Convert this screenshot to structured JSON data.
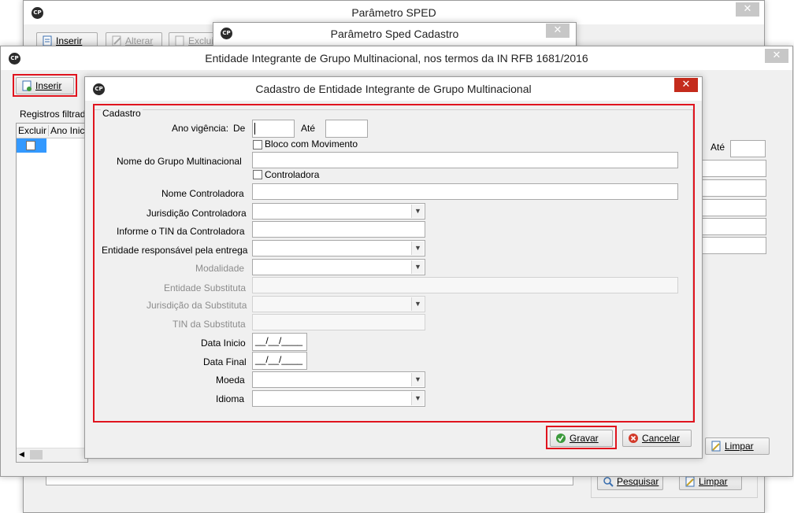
{
  "win_sped": {
    "title": "Parâmetro SPED",
    "toolbar": {
      "inserir": "Inserir",
      "alterar": "Alterar",
      "excluir": "Excluir"
    },
    "bottom": {
      "pesquisar": "Pesquisar",
      "limpar": "Limpar"
    }
  },
  "win_sped_cadastro": {
    "title": "Parâmetro Sped Cadastro"
  },
  "win_entidade": {
    "title": "Entidade Integrante de Grupo Multinacional, nos termos da IN RFB 1681/2016",
    "inserir": "Inserir",
    "registros_label": "Registros filtrados",
    "columns": [
      "Excluir",
      "Ano Inicio"
    ],
    "filter_ate": "Até",
    "limpar": "Limpar"
  },
  "dialog": {
    "title": "Cadastro de Entidade Integrante de Grupo Multinacional",
    "group_label": "Cadastro",
    "ano_vigencia_label": "Ano vigência:",
    "de_label": "De",
    "ate_label": "Até",
    "ano_de_value": "",
    "ano_ate_value": "",
    "bloco_label": "Bloco com Movimento",
    "nome_grupo_label": "Nome do Grupo Multinacional",
    "controladora_chk_label": "Controladora",
    "nome_controladora_label": "Nome Controladora",
    "jurisdicao_controladora_label": "Jurisdição Controladora",
    "tin_controladora_label": "Informe o TIN da Controladora",
    "entidade_responsavel_label": "Entidade responsável pela entrega",
    "modalidade_label": "Modalidade",
    "entidade_substituta_label": "Entidade Substituta",
    "jurisdicao_substituta_label": "Jurisdição da Substituta",
    "tin_substituta_label": "TIN da Substituta",
    "data_inicio_label": "Data Inicio",
    "data_inicio_value": "__/__/____",
    "data_final_label": "Data Final",
    "data_final_value": "__/__/____",
    "moeda_label": "Moeda",
    "idioma_label": "Idioma",
    "gravar": "Gravar",
    "cancelar": "Cancelar"
  },
  "logo_text": "CP",
  "colors": {
    "highlight": "#e0141e",
    "close_red": "#c42b1c",
    "face": "#f0f0f0"
  },
  "icons": [
    "app-logo-icon",
    "close-icon",
    "insert-doc-icon",
    "edit-icon",
    "delete-icon",
    "search-icon",
    "clear-icon",
    "check-icon",
    "cancel-icon",
    "chevron-down-icon"
  ]
}
